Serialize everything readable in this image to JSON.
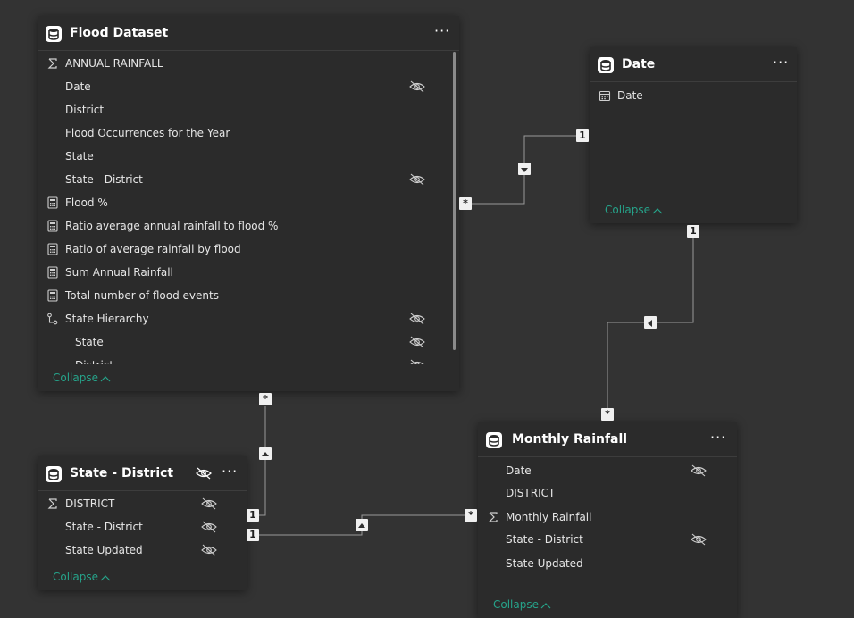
{
  "tables": {
    "flood": {
      "title": "Flood Dataset",
      "more": "···",
      "fields": [
        {
          "label": "ANNUAL RAINFALL",
          "icon": "sigma-icon",
          "hidden": false
        },
        {
          "label": "Date",
          "icon": "none",
          "hidden": true
        },
        {
          "label": "District",
          "icon": "none",
          "hidden": false
        },
        {
          "label": "Flood Occurrences for the Year",
          "icon": "none",
          "hidden": false
        },
        {
          "label": "State",
          "icon": "none",
          "hidden": false
        },
        {
          "label": "State - District",
          "icon": "none",
          "hidden": true
        },
        {
          "label": "Flood %",
          "icon": "calculator-icon",
          "hidden": false
        },
        {
          "label": "Ratio average annual rainfall to flood %",
          "icon": "calculator-icon",
          "hidden": false
        },
        {
          "label": "Ratio of average rainfall by flood",
          "icon": "calculator-icon",
          "hidden": false
        },
        {
          "label": "Sum Annual Rainfall",
          "icon": "calculator-icon",
          "hidden": false
        },
        {
          "label": "Total number of flood events",
          "icon": "calculator-icon",
          "hidden": false
        },
        {
          "label": "State Hierarchy",
          "icon": "hierarchy-icon",
          "hidden": true
        },
        {
          "label": "State",
          "icon": "none",
          "hidden": true
        },
        {
          "label": "District",
          "icon": "none",
          "hidden": true
        }
      ],
      "collapse": "Collapse"
    },
    "date": {
      "title": "Date",
      "more": "···",
      "fields": [
        {
          "label": "Date",
          "icon": "calendar-icon",
          "hidden": false
        }
      ],
      "collapse": "Collapse"
    },
    "state_district": {
      "title": "State - District",
      "more": "···",
      "header_hidden": true,
      "fields": [
        {
          "label": "DISTRICT",
          "icon": "sigma-icon",
          "hidden": true
        },
        {
          "label": "State - District",
          "icon": "none",
          "hidden": true
        },
        {
          "label": "State Updated",
          "icon": "none",
          "hidden": true
        }
      ],
      "collapse": "Collapse"
    },
    "monthly": {
      "title": "Monthly Rainfall",
      "more": "···",
      "fields": [
        {
          "label": "Date",
          "icon": "none",
          "hidden": true
        },
        {
          "label": "DISTRICT",
          "icon": "none",
          "hidden": false
        },
        {
          "label": "Monthly Rainfall",
          "icon": "sigma-icon",
          "hidden": false
        },
        {
          "label": "State - District",
          "icon": "none",
          "hidden": true
        },
        {
          "label": "State Updated",
          "icon": "none",
          "hidden": false
        }
      ],
      "collapse": "Collapse"
    }
  },
  "relationships": {
    "one_label": "1",
    "many_label": "*"
  },
  "colors": {
    "canvas": "#333333",
    "card": "#2b2b2b",
    "accent": "#26a38a",
    "line": "#9a9a9a"
  }
}
